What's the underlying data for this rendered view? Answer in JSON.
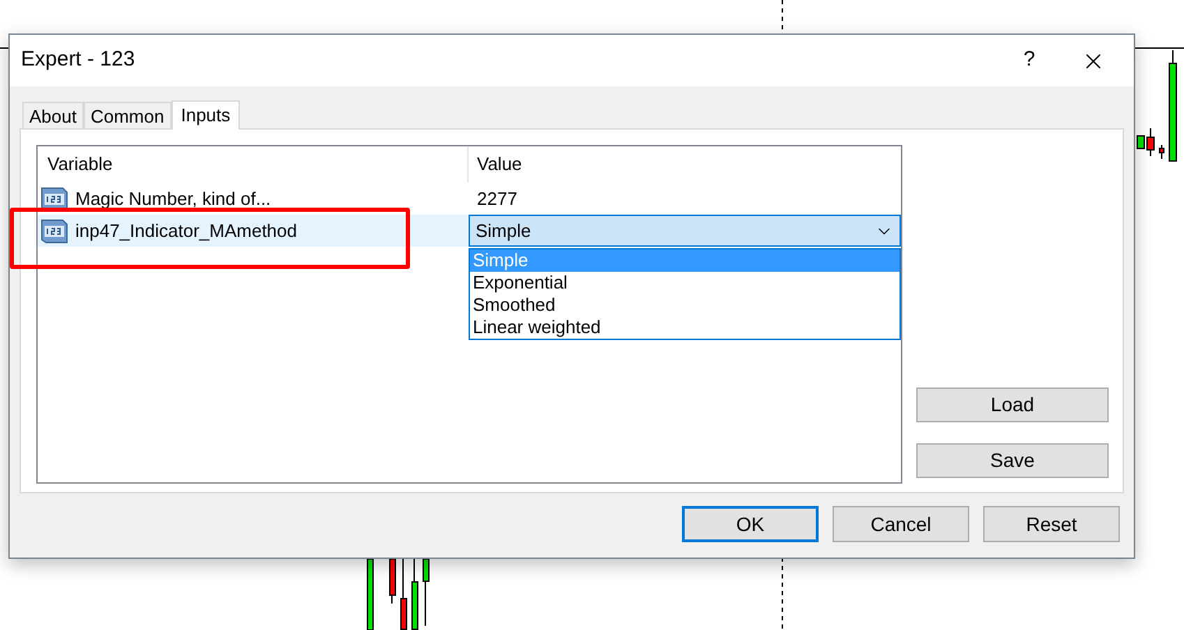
{
  "window": {
    "title": "Expert - 123",
    "help_glyph": "?"
  },
  "tabs": [
    {
      "label": "About",
      "selected": false
    },
    {
      "label": "Common",
      "selected": false
    },
    {
      "label": "Inputs",
      "selected": true
    }
  ],
  "table": {
    "columns": [
      "Variable",
      "Value"
    ],
    "rows": [
      {
        "variable": "Magic Number, kind of...",
        "value": "2277",
        "kind": "text",
        "selected": false
      },
      {
        "variable": "inp47_Indicator_MAmethod",
        "value": "Simple",
        "kind": "dropdown",
        "selected": true,
        "highlighted": true
      }
    ]
  },
  "dropdown_options": [
    {
      "label": "Simple",
      "selected": true
    },
    {
      "label": "Exponential",
      "selected": false
    },
    {
      "label": "Smoothed",
      "selected": false
    },
    {
      "label": "Linear weighted",
      "selected": false
    }
  ],
  "side_buttons": [
    "Load",
    "Save"
  ],
  "buttons": [
    {
      "label": "OK",
      "default": true
    },
    {
      "label": "Cancel",
      "default": false
    },
    {
      "label": "Reset",
      "default": false
    }
  ]
}
